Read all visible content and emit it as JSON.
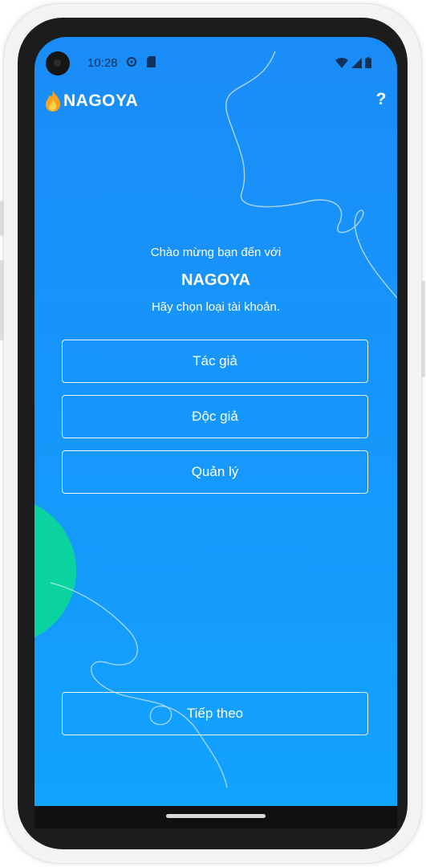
{
  "status_bar": {
    "time": "10:28"
  },
  "header": {
    "app_name": "NAGOYA",
    "help_label": "?"
  },
  "welcome": {
    "greeting": "Chào mừng bạn đến với",
    "brand": "NAGOYA",
    "prompt": "Hãy chọn loại tài khoản."
  },
  "account_types": [
    {
      "label": "Tác giả"
    },
    {
      "label": "Độc giả"
    },
    {
      "label": "Quản lý"
    }
  ],
  "footer": {
    "next_label": "Tiếp theo"
  },
  "colors": {
    "screen_bg": "#1a8cf7",
    "accent_circle": "#0bd3a0",
    "text": "#ffffff"
  },
  "icons": {
    "logo": "flame-icon",
    "settings": "gear-icon",
    "sim": "sim-card-icon",
    "wifi": "wifi-icon",
    "signal": "signal-icon",
    "battery": "battery-icon"
  }
}
